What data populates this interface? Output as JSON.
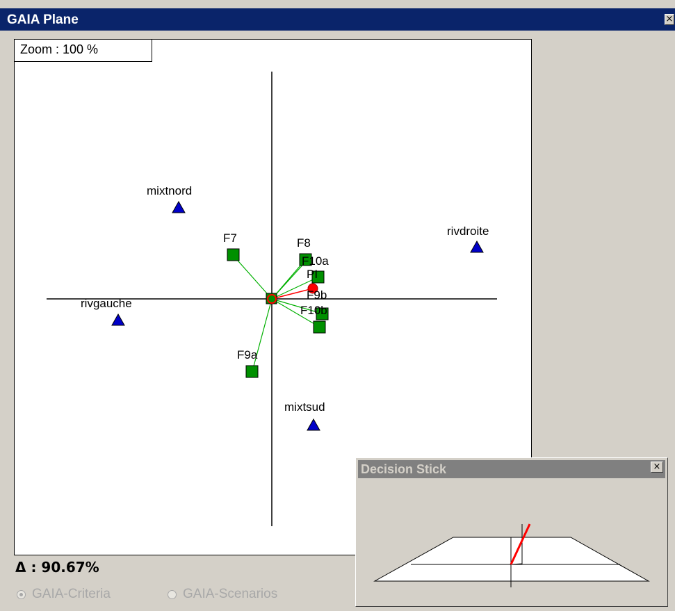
{
  "window": {
    "title": "GAIA Plane",
    "close_glyph": "×"
  },
  "plot": {
    "zoom_label": "Zoom : 100 %",
    "criteria_labels": [
      "mixtnord",
      "rivdroite",
      "rivgauche",
      "mixtsud"
    ],
    "action_labels": [
      "F7",
      "F8",
      "F10a",
      "F9b",
      "F10b",
      "F9a",
      "PI"
    ],
    "colors": {
      "criteria": "#0000c8",
      "actions": "#008000",
      "links": "#00b000",
      "decision_axis": "#ff0000"
    }
  },
  "footer": {
    "delta": "Δ : 90.67%",
    "radio_criteria": "GAIA-Criteria",
    "radio_scenarios": "GAIA-Scenarios",
    "selected": "GAIA-Criteria"
  },
  "decision_stick": {
    "title": "Decision Stick",
    "close_glyph": "×"
  }
}
